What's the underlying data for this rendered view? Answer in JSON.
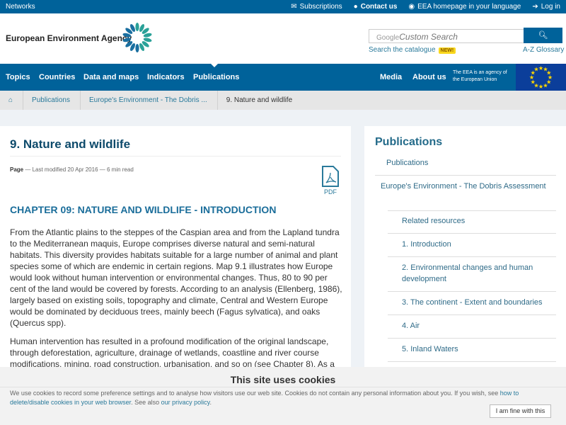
{
  "topbar": {
    "networks": "Networks",
    "subscriptions": "Subscriptions",
    "contact": "Contact us",
    "homepage": "EEA homepage in your language",
    "login": "Log in"
  },
  "header": {
    "logo": "European Environment Agency",
    "search_brand": "Google",
    "search_placeholder": "Custom Search",
    "catalogue": "Search the catalogue",
    "new_badge": "NEW!",
    "glossary": "A-Z Glossary"
  },
  "nav": {
    "items": [
      "Topics",
      "Countries",
      "Data and maps",
      "Indicators",
      "Publications"
    ],
    "media": "Media",
    "about": "About us",
    "eu_note": "The EEA is an agency of the European Union"
  },
  "breadcrumb": [
    "Publications",
    "Europe's Environment - The Dobris ...",
    "9. Nature and wildlife"
  ],
  "main": {
    "title": "9. Nature and wildlife",
    "meta_type": "Page",
    "meta_modified": "Last modified 20 Apr 2016",
    "meta_read": "6 min read",
    "pdf": "PDF",
    "chapter": "CHAPTER 09: NATURE AND WILDLIFE - INTRODUCTION",
    "paragraphs": [
      "From the Atlantic plains to the steppes of the Caspian area and from the Lapland tundra to the Mediterranean maquis, Europe comprises diverse natural and semi-natural habitats. This diversity provides habitats suitable for a large number of animal and plant species some of which are endemic in certain regions. Map 9.1 illustrates how Europe would look without human intervention or environmental changes. Thus, 80 to 90 per cent of the land would be covered by forests. According to an analysis (Ellenberg, 1986), largely based on existing soils, topography and climate, Central and Western Europe would be dominated by deciduous trees, mainly beech (Fagus sylvatica), and oaks (Quercus spp).",
      "Human intervention has resulted in a profound modification of the original landscape, through deforestation, agriculture, drainage of wetlands, coastline and river course modifications, mining, road construction, urbanisation, and so on (see Chapter 8). As a result, many animals and plants have had to find refuge in relatively small enclaves, sometimes only"
    ]
  },
  "sidebar": {
    "title": "Publications",
    "items": [
      "Publications",
      "Europe's Environment - The Dobris Assessment",
      "Related resources",
      "1. Introduction",
      "2. Environmental changes and human development",
      "3. The continent - Extent and boundaries",
      "4. Air",
      "5. Inland Waters"
    ]
  },
  "cookie": {
    "title": "This site uses cookies",
    "text": "We use cookies to record some preference settings and to analyse how visitors use our web site. Cookies do not contain any personal information about you. If you wish, see ",
    "link1": "how to delete/disable cookies in your web browser",
    "text2": ". See also ",
    "link2": "our privacy policy",
    "text3": ".",
    "button": "I am fine with this"
  }
}
